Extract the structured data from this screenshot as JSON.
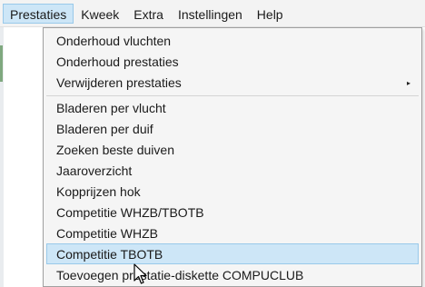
{
  "menubar": {
    "items": [
      {
        "label": "Prestaties",
        "active": true
      },
      {
        "label": "Kweek"
      },
      {
        "label": "Extra"
      },
      {
        "label": "Instellingen"
      },
      {
        "label": "Help"
      }
    ]
  },
  "dropdown": {
    "items": [
      {
        "label": "Onderhoud vluchten"
      },
      {
        "label": "Onderhoud prestaties"
      },
      {
        "label": "Verwijderen prestaties",
        "submenu": true,
        "arrow": "▸"
      },
      {
        "label": "Bladeren per vlucht"
      },
      {
        "label": "Bladeren per duif"
      },
      {
        "label": "Zoeken beste duiven"
      },
      {
        "label": "Jaaroverzicht"
      },
      {
        "label": "Kopprijzen hok"
      },
      {
        "label": "Competitie WHZB/TBOTB"
      },
      {
        "label": "Competitie WHZB"
      },
      {
        "label": "Competitie TBOTB",
        "highlighted": true
      },
      {
        "label": "Toevoegen prestatie-diskette COMPUCLUB"
      }
    ]
  },
  "colors": {
    "highlight_bg": "#cde6f7",
    "highlight_border": "#99c9ea",
    "menu_bg": "#f5f5f5",
    "menubar_bg": "#f3f3f3"
  },
  "icons": {
    "cursor": "mouse-pointer-icon",
    "submenu_arrow": "submenu-arrow-icon"
  }
}
